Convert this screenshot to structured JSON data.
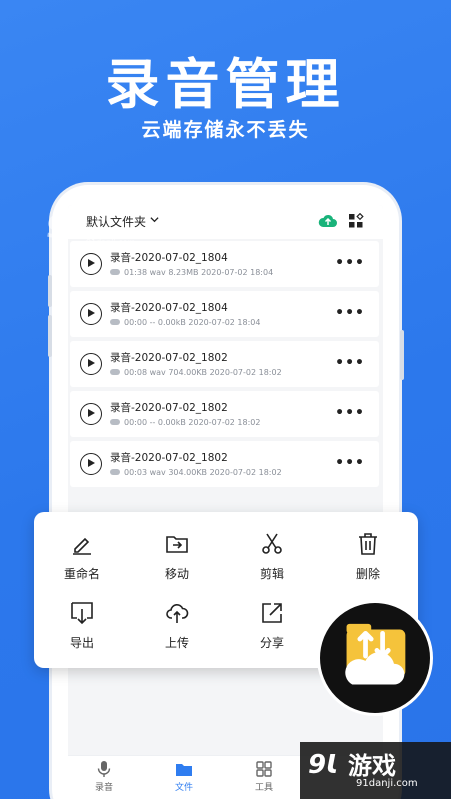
{
  "promo": {
    "headline": "录音管理",
    "subline": "云端存储永不丢失"
  },
  "screen": {
    "folder_title": "默认文件夹",
    "header_icons": [
      "chevron-down-icon",
      "cloud-upload-icon",
      "grid-icon"
    ],
    "recordings": [
      {
        "name": "录音-2020-07-02_1804",
        "meta": "01:38  wav  8.23MB  2020-07-02 18:04"
      },
      {
        "name": "录音-2020-07-02_1804",
        "meta": "00:00  --  0.00kB  2020-07-02 18:04"
      },
      {
        "name": "录音-2020-07-02_1802",
        "meta": "00:08  wav  704.00KB  2020-07-02 18:02"
      },
      {
        "name": "录音-2020-07-02_1802",
        "meta": "00:00  --  0.00kB  2020-07-02 18:02"
      },
      {
        "name": "录音-2020-07-02_1802",
        "meta": "00:03  wav  304.00KB  2020-07-02 18:02"
      }
    ],
    "more_symbol": "•••",
    "tabs": [
      {
        "label": "录音",
        "icon": "microphone-icon"
      },
      {
        "label": "文件",
        "icon": "folder-icon",
        "active": true
      },
      {
        "label": "工具",
        "icon": "tools-icon"
      }
    ]
  },
  "actions": {
    "rename": "重命名",
    "move": "移动",
    "cut": "剪辑",
    "delete": "删除",
    "export": "导出",
    "upload": "上传",
    "share": "分享"
  },
  "watermark": {
    "left_logo": "9Ɩ",
    "left_site": "91danji.com",
    "right_logo": "9Ɩ",
    "right_brand": "游戏",
    "right_site": "91danji.com"
  },
  "colors": {
    "background": "#2f7df0",
    "accent_green": "#19b37a",
    "active_tab": "#2f7df0"
  }
}
